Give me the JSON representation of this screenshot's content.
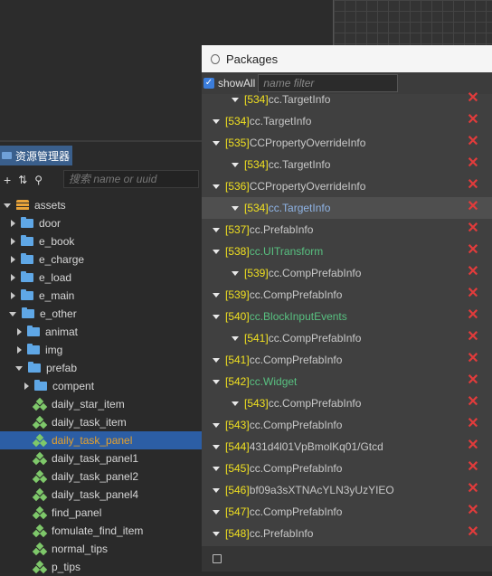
{
  "assets_panel": {
    "tab_label": "资源管理器",
    "search_placeholder": "搜索 name or uuid",
    "tree": [
      {
        "label": "assets",
        "level": 0,
        "icon": "db-icon",
        "expanded": true
      },
      {
        "label": "door",
        "level": 1,
        "icon": "folder-icon",
        "expanded": false
      },
      {
        "label": "e_book",
        "level": 1,
        "icon": "folder-icon",
        "expanded": false
      },
      {
        "label": "e_charge",
        "level": 1,
        "icon": "folder-icon",
        "expanded": false
      },
      {
        "label": "e_load",
        "level": 1,
        "icon": "folder-icon",
        "expanded": false
      },
      {
        "label": "e_main",
        "level": 1,
        "icon": "folder-icon",
        "expanded": false
      },
      {
        "label": "e_other",
        "level": 1,
        "icon": "folder-icon",
        "expanded": true
      },
      {
        "label": "animat",
        "level": 2,
        "icon": "folder-icon",
        "expanded": false
      },
      {
        "label": "img",
        "level": 2,
        "icon": "folder-icon",
        "expanded": false
      },
      {
        "label": "prefab",
        "level": 2,
        "icon": "folder-icon",
        "expanded": true
      },
      {
        "label": "compent",
        "level": 3,
        "icon": "folder-icon",
        "expanded": false
      },
      {
        "label": "daily_star_item",
        "level": 3,
        "icon": "prefab-icon"
      },
      {
        "label": "daily_task_item",
        "level": 3,
        "icon": "prefab-icon"
      },
      {
        "label": "daily_task_panel",
        "level": 3,
        "icon": "prefab-icon",
        "selected": true
      },
      {
        "label": "daily_task_panel1",
        "level": 3,
        "icon": "prefab-icon"
      },
      {
        "label": "daily_task_panel2",
        "level": 3,
        "icon": "prefab-icon"
      },
      {
        "label": "daily_task_panel4",
        "level": 3,
        "icon": "prefab-icon"
      },
      {
        "label": "find_panel",
        "level": 3,
        "icon": "prefab-icon"
      },
      {
        "label": "fomulate_find_item",
        "level": 3,
        "icon": "prefab-icon"
      },
      {
        "label": "normal_tips",
        "level": 3,
        "icon": "prefab-icon"
      },
      {
        "label": "p_tips",
        "level": 3,
        "icon": "prefab-icon"
      }
    ]
  },
  "packages": {
    "title": "Packages",
    "show_all_label": "showAll",
    "show_all_checked": true,
    "filter_placeholder": "name filter",
    "rows": [
      {
        "indent": 1,
        "id": "[534]",
        "name": "cc.TargetInfo"
      },
      {
        "indent": 0,
        "id": "[534]",
        "name": "cc.TargetInfo"
      },
      {
        "indent": 0,
        "id": "[535]",
        "name": "CCPropertyOverrideInfo"
      },
      {
        "indent": 1,
        "id": "[534]",
        "name": "cc.TargetInfo"
      },
      {
        "indent": 0,
        "id": "[536]",
        "name": "CCPropertyOverrideInfo"
      },
      {
        "indent": 1,
        "id": "[534]",
        "name": "cc.TargetInfo",
        "highlight": true
      },
      {
        "indent": 0,
        "id": "[537]",
        "name": "cc.PrefabInfo"
      },
      {
        "indent": 0,
        "id": "[538]",
        "name": "cc.UITransform",
        "green": true
      },
      {
        "indent": 1,
        "id": "[539]",
        "name": "cc.CompPrefabInfo"
      },
      {
        "indent": 0,
        "id": "[539]",
        "name": "cc.CompPrefabInfo"
      },
      {
        "indent": 0,
        "id": "[540]",
        "name": "cc.BlockInputEvents",
        "green": true
      },
      {
        "indent": 1,
        "id": "[541]",
        "name": "cc.CompPrefabInfo"
      },
      {
        "indent": 0,
        "id": "[541]",
        "name": "cc.CompPrefabInfo"
      },
      {
        "indent": 0,
        "id": "[542]",
        "name": "cc.Widget",
        "green": true
      },
      {
        "indent": 1,
        "id": "[543]",
        "name": "cc.CompPrefabInfo"
      },
      {
        "indent": 0,
        "id": "[543]",
        "name": "cc.CompPrefabInfo"
      },
      {
        "indent": 0,
        "id": "[544]",
        "name": "431d4l01VpBmolKq01/Gtcd"
      },
      {
        "indent": 0,
        "id": "[545]",
        "name": "cc.CompPrefabInfo"
      },
      {
        "indent": 0,
        "id": "[546]",
        "name": "bf09a3sXTNAcYLN3yUzYIEO"
      },
      {
        "indent": 0,
        "id": "[547]",
        "name": "cc.CompPrefabInfo"
      },
      {
        "indent": 0,
        "id": "[548]",
        "name": "cc.PrefabInfo"
      }
    ]
  },
  "colors": {
    "accent": "#2c5ea5",
    "selected_text": "#e6a12c",
    "id_yellow": "#f0e020",
    "component_green": "#58c080",
    "delete_red": "#e23b3b"
  }
}
